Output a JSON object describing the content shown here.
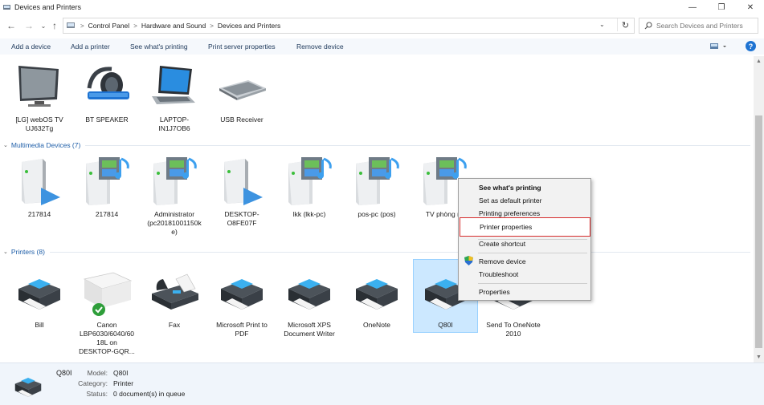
{
  "window": {
    "title": "Devices and Printers",
    "controls": {
      "minimize": "—",
      "maximize": "❐",
      "close": "✕"
    }
  },
  "address_bar": {
    "breadcrumbs": [
      "Control Panel",
      "Hardware and Sound",
      "Devices and Printers"
    ],
    "search_placeholder": "Search Devices and Printers"
  },
  "toolbar": {
    "add_device": "Add a device",
    "add_printer": "Add a printer",
    "see_printing": "See what's printing",
    "print_server": "Print server properties",
    "remove_device": "Remove device",
    "help": "?"
  },
  "devices_top": [
    {
      "label": "[LG] webOS TV UJ632Tg",
      "icon": "monitor-icon"
    },
    {
      "label": "BT SPEAKER",
      "icon": "headset-icon"
    },
    {
      "label": "LAPTOP-IN1J7OB6",
      "icon": "laptop-icon"
    },
    {
      "label": "USB Receiver",
      "icon": "keyboard-icon"
    }
  ],
  "multimedia": {
    "header": "Multimedia Devices (7)",
    "items": [
      {
        "label": "217814",
        "icon": "media-server-play-icon"
      },
      {
        "label": "217814",
        "icon": "media-server-film-icon"
      },
      {
        "label": "Administrator (pc20181001150ke)",
        "icon": "media-server-film-icon"
      },
      {
        "label": "DESKTOP-O8FE07F",
        "icon": "media-server-play-icon"
      },
      {
        "label": "lkk (lkk-pc)",
        "icon": "media-server-film-icon"
      },
      {
        "label": "pos-pc (pos)",
        "icon": "media-server-film-icon"
      },
      {
        "label": "TV phòng m",
        "icon": "media-server-film-icon"
      }
    ]
  },
  "printers": {
    "header": "Printers (8)",
    "items": [
      {
        "label": "Bill",
        "icon": "printer-icon"
      },
      {
        "label": "Canon LBP6030/6040/6018L on DESKTOP-GQR...",
        "icon": "laser-printer-icon"
      },
      {
        "label": "Fax",
        "icon": "fax-icon"
      },
      {
        "label": "Microsoft Print to PDF",
        "icon": "printer-icon"
      },
      {
        "label": "Microsoft XPS Document Writer",
        "icon": "printer-icon"
      },
      {
        "label": "OneNote",
        "icon": "printer-icon"
      },
      {
        "label": "Q80I",
        "icon": "printer-icon"
      },
      {
        "label": "Send To OneNote 2010",
        "icon": "printer-icon"
      }
    ]
  },
  "context_menu": {
    "items": [
      "See what's printing",
      "Set as default printer",
      "Printing preferences",
      "Printer properties",
      "Create shortcut",
      "Remove device",
      "Troubleshoot",
      "Properties"
    ],
    "highlighted": "Printer properties"
  },
  "details": {
    "name": "Q80I",
    "model_label": "Model:",
    "model": "Q80I",
    "category_label": "Category:",
    "category": "Printer",
    "status_label": "Status:",
    "status": "0 document(s) in queue"
  },
  "colors": {
    "accent": "#1e73d2",
    "selection": "#cce8ff",
    "highlight_border": "#d62b2b",
    "group_header": "#1e5ea8"
  }
}
